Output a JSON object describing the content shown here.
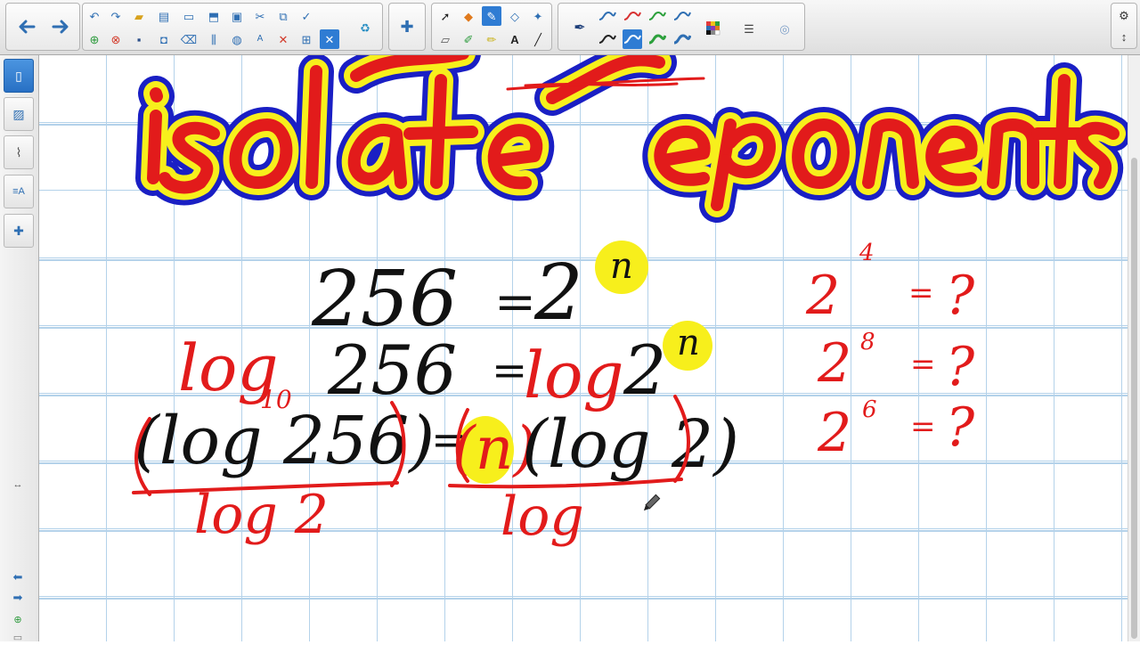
{
  "toolbar": {
    "nav": [
      "back-arrow-icon",
      "forward-arrow-icon"
    ],
    "file_tools": [
      "undo-icon",
      "redo-icon",
      "open-folder-icon",
      "insert-page-icon",
      "screen-shade-icon",
      "page-capture-icon",
      "document-camera-icon",
      "cut-icon",
      "paste-icon",
      "spellcheck-icon",
      "new-page-icon",
      "delete-page-icon",
      "save-icon",
      "screen-capture-icon",
      "clear-ink-icon",
      "table-cells-icon",
      "web-icon",
      "text-format-icon",
      "delete-icon",
      "insert-table-icon",
      "close-box-icon",
      "recycle-icon"
    ],
    "addon": "puzzle-icon",
    "draw_tools": [
      "select-arrow-icon",
      "shapes-icon",
      "pen-icon",
      "highlighter-eraser-icon",
      "magic-pen-icon",
      "eraser-icon",
      "creative-pen-icon",
      "fill-icon",
      "text-tool-icon",
      "line-tool-icon"
    ],
    "pen_styles": [
      "line-style-icon",
      "line-style-icon",
      "line-style-icon",
      "line-style-icon",
      "line-style-icon",
      "line-style-icon",
      "line-style-icon",
      "line-style-icon"
    ],
    "props": [
      "color-palette-icon",
      "line-width-icon",
      "pen-effects-icon"
    ],
    "right": [
      "gear-icon",
      "updown-arrow-icon"
    ]
  },
  "sidebar": {
    "tabs": [
      "page-sorter-icon",
      "gallery-icon",
      "attachments-icon",
      "properties-icon",
      "addons-icon"
    ],
    "bottom": [
      "back-arrow-icon",
      "forward-arrow-icon",
      "add-page-icon",
      "delete-page-icon"
    ],
    "resize": "resize-handle-icon"
  },
  "colors": {
    "grid": "#b4d2ea",
    "ink_red": "#e21b1b",
    "ink_black": "#111111",
    "highlight_yellow": "#f7ef1c",
    "outline_blue": "#1a1fc4",
    "accent_blue": "#2f7cd3"
  },
  "ink": {
    "heading": [
      "isolate",
      "exponents"
    ],
    "eq1": [
      "256",
      "=",
      "2",
      "n"
    ],
    "eq2": [
      "log",
      "10",
      "256",
      "=",
      "log",
      "2",
      "n"
    ],
    "eq3": [
      "(log 256)",
      "=",
      "(n)",
      "(log 2)"
    ],
    "denominators": [
      "log 2",
      "log"
    ],
    "side": [
      [
        "2",
        "4",
        "=",
        "?"
      ],
      [
        "2",
        "8",
        "=",
        "?"
      ],
      [
        "2",
        "6",
        "=",
        "?"
      ]
    ]
  }
}
